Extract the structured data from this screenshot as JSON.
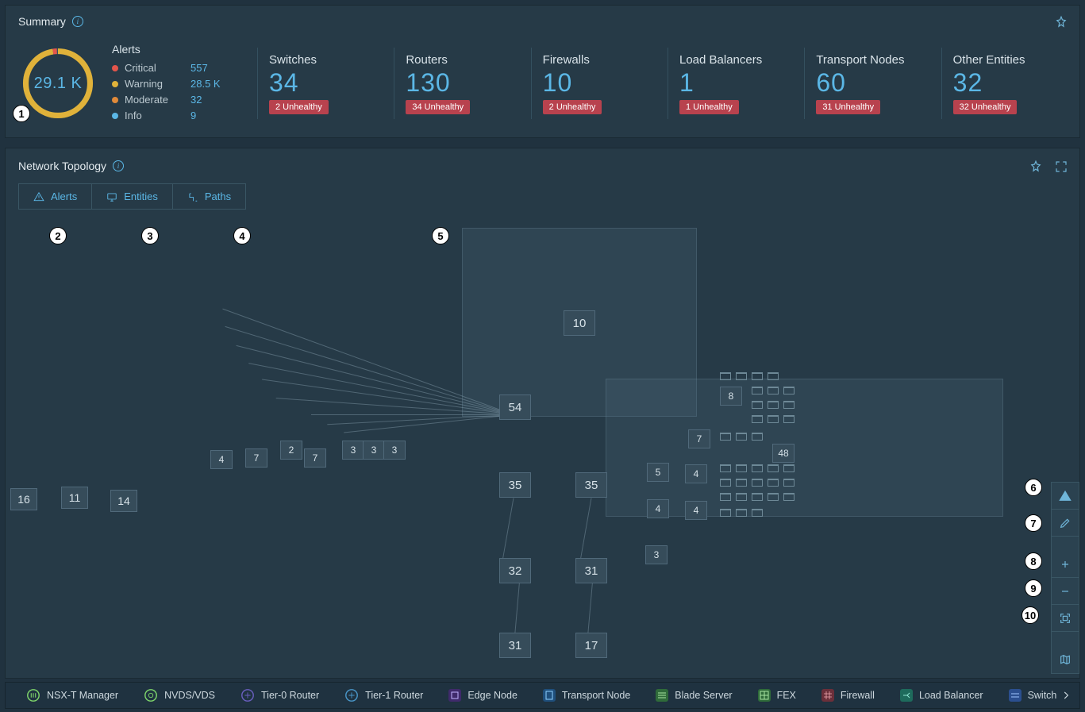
{
  "summary": {
    "title": "Summary",
    "donut_total": "29.1 K",
    "alerts_heading": "Alerts",
    "alerts": [
      {
        "label": "Critical",
        "value": "557",
        "color": "#e3554b"
      },
      {
        "label": "Warning",
        "value": "28.5 K",
        "color": "#e0b23a"
      },
      {
        "label": "Moderate",
        "value": "32",
        "color": "#e08a3a"
      },
      {
        "label": "Info",
        "value": "9",
        "color": "#5bb7e6"
      }
    ],
    "stats": [
      {
        "label": "Switches",
        "value": "34",
        "unhealthy": "2 Unhealthy"
      },
      {
        "label": "Routers",
        "value": "130",
        "unhealthy": "34 Unhealthy"
      },
      {
        "label": "Firewalls",
        "value": "10",
        "unhealthy": "2 Unhealthy"
      },
      {
        "label": "Load Balancers",
        "value": "1",
        "unhealthy": "1 Unhealthy"
      },
      {
        "label": "Transport Nodes",
        "value": "60",
        "unhealthy": "31 Unhealthy"
      },
      {
        "label": "Other Entities",
        "value": "32",
        "unhealthy": "32 Unhealthy"
      }
    ]
  },
  "topology": {
    "title": "Network Topology",
    "tabs": [
      {
        "icon": "alert",
        "label": "Alerts"
      },
      {
        "icon": "entities",
        "label": "Entities"
      },
      {
        "icon": "paths",
        "label": "Paths"
      }
    ],
    "nodes": {
      "n10": "10",
      "n54": "54",
      "n35a": "35",
      "n35b": "35",
      "n32": "32",
      "n31a": "31",
      "n31b": "31",
      "n17": "17",
      "n16": "16",
      "n11": "11",
      "n14": "14",
      "n4a": "4",
      "n7a": "7",
      "n2": "2",
      "n7b": "7",
      "n3a": "3",
      "n3b": "3",
      "n3c": "3",
      "n8": "8",
      "n7c": "7",
      "n48": "48",
      "n5": "5",
      "n4b": "4",
      "n4c": "4",
      "n4d": "4",
      "n3d": "3"
    },
    "tools": {
      "alerts_overlay": "Alerts",
      "edit": "Edit",
      "zoom_in": "Zoom in",
      "zoom_out": "Zoom out",
      "fit": "Fit",
      "minimap": "Minimap"
    }
  },
  "callouts": {
    "c1": "1",
    "c2": "2",
    "c3": "3",
    "c4": "4",
    "c5": "5",
    "c6": "6",
    "c7": "7",
    "c8": "8",
    "c9": "9",
    "c10": "10"
  },
  "legend": [
    {
      "label": "NSX-T Manager",
      "shape": "circle",
      "stroke": "#7fd66b"
    },
    {
      "label": "NVDS/VDS",
      "shape": "circle",
      "stroke": "#7fd66b"
    },
    {
      "label": "Tier-0 Router",
      "shape": "circle",
      "stroke": "#6a5fbf"
    },
    {
      "label": "Tier-1 Router",
      "shape": "circle",
      "stroke": "#4a97c9"
    },
    {
      "label": "Edge Node",
      "shape": "square",
      "fill": "#3f2a6b"
    },
    {
      "label": "Transport Node",
      "shape": "square",
      "fill": "#1f4f7c"
    },
    {
      "label": "Blade Server",
      "shape": "square",
      "fill": "#2f6b3a"
    },
    {
      "label": "FEX",
      "shape": "square",
      "fill": "#2f6b3a"
    },
    {
      "label": "Firewall",
      "shape": "square",
      "fill": "#6b2f3a"
    },
    {
      "label": "Load Balancer",
      "shape": "square",
      "fill": "#1e6b5c"
    },
    {
      "label": "Switch",
      "shape": "square",
      "fill": "#2b4f8f"
    }
  ]
}
